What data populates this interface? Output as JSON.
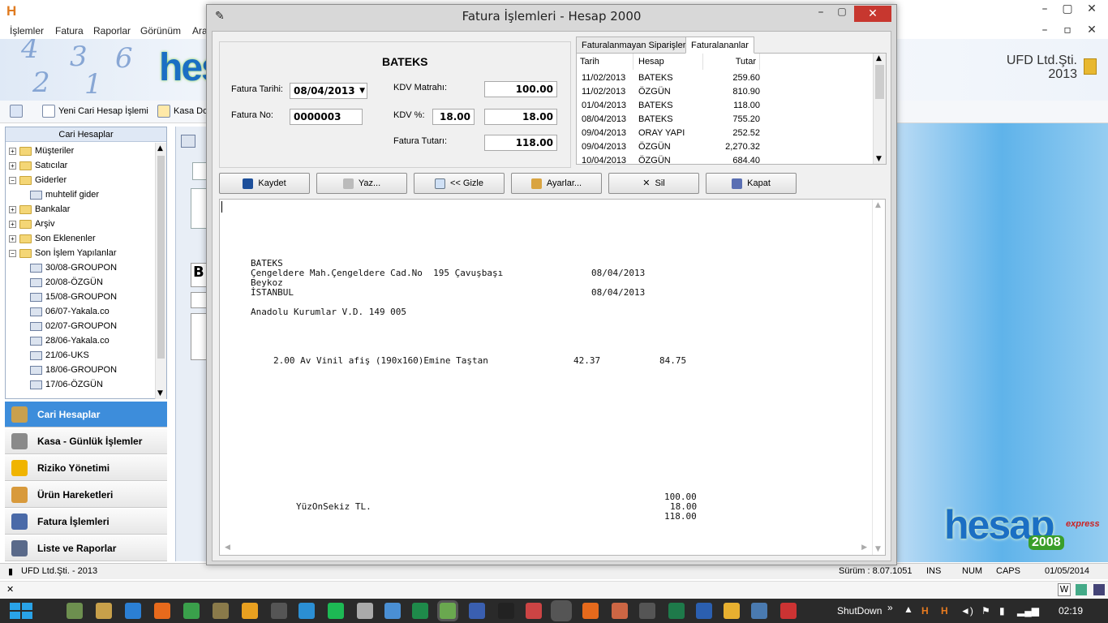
{
  "app": {
    "menu": [
      "İşlemler",
      "Fatura",
      "Raporlar",
      "Görünüm",
      "Ara"
    ],
    "company": "UFD Ltd.Şti.",
    "year": "2013",
    "toolbar": {
      "new_account": "Yeni Cari Hesap İşlemi",
      "cash": "Kasa Do"
    },
    "left_header": "Cari Hesaplar",
    "tree": [
      {
        "label": "Müşteriler",
        "level": 0,
        "type": "folder",
        "exp": "+"
      },
      {
        "label": "Satıcılar",
        "level": 0,
        "type": "folder",
        "exp": "+"
      },
      {
        "label": "Giderler",
        "level": 0,
        "type": "folder",
        "exp": "−"
      },
      {
        "label": "muhtelif gider",
        "level": 1,
        "type": "card",
        "exp": ""
      },
      {
        "label": "Bankalar",
        "level": 0,
        "type": "folder",
        "exp": "+"
      },
      {
        "label": "Arşiv",
        "level": 0,
        "type": "folder",
        "exp": "+"
      },
      {
        "label": "Son Eklenenler",
        "level": 0,
        "type": "folder",
        "exp": "+"
      },
      {
        "label": "Son İşlem Yapılanlar",
        "level": 0,
        "type": "folder",
        "exp": "−"
      },
      {
        "label": "30/08-GROUPON",
        "level": 1,
        "type": "card",
        "exp": ""
      },
      {
        "label": "20/08-ÖZGÜN",
        "level": 1,
        "type": "card",
        "exp": ""
      },
      {
        "label": "15/08-GROUPON",
        "level": 1,
        "type": "card",
        "exp": ""
      },
      {
        "label": "06/07-Yakala.co",
        "level": 1,
        "type": "card",
        "exp": ""
      },
      {
        "label": "02/07-GROUPON",
        "level": 1,
        "type": "card",
        "exp": ""
      },
      {
        "label": "28/06-Yakala.co",
        "level": 1,
        "type": "card",
        "exp": ""
      },
      {
        "label": "21/06-UKS",
        "level": 1,
        "type": "card",
        "exp": ""
      },
      {
        "label": "18/06-GROUPON",
        "level": 1,
        "type": "card",
        "exp": ""
      },
      {
        "label": "17/06-ÖZGÜN",
        "level": 1,
        "type": "card",
        "exp": ""
      }
    ],
    "nav": [
      "Cari Hesaplar",
      "Kasa - Günlük İşlemler",
      "Riziko Yönetimi",
      "Ürün Hareketleri",
      "Fatura İşlemleri",
      "Liste ve Raporlar"
    ],
    "nav_active": 0,
    "status": {
      "company": "UFD Ltd.Şti. - 2013",
      "version": "Sürüm : 8.07.1051",
      "ins": "INS",
      "num": "NUM",
      "caps": "CAPS",
      "date": "01/05/2014"
    },
    "logo_text": "hesap",
    "logo_express": "express",
    "logo_year": "2008"
  },
  "dialog": {
    "title": "Fatura İşlemleri - Hesap 2000",
    "customer": "BATEKS",
    "date_label": "Fatura Tarihi:",
    "date_value": "08/04/2013",
    "no_label": "Fatura No:",
    "no_value": "0000003",
    "kdv_base_label": "KDV Matrahı:",
    "kdv_base_value": "100.00",
    "kdv_pct_label": "KDV %:",
    "kdv_pct_value": "18.00",
    "kdv_amount_value": "18.00",
    "total_label": "Fatura Tutarı:",
    "total_value": "118.00",
    "tabs": [
      "Faturalanmayan Siparişler",
      "Faturalananlar"
    ],
    "active_tab": 1,
    "grid_headers": [
      "Tarih",
      "Hesap",
      "Tutar"
    ],
    "grid_rows": [
      [
        "11/02/2013",
        "BATEKS",
        "259.60"
      ],
      [
        "11/02/2013",
        "ÖZGÜN",
        "810.90"
      ],
      [
        "01/04/2013",
        "BATEKS",
        "118.00"
      ],
      [
        "08/04/2013",
        "BATEKS",
        "755.20"
      ],
      [
        "09/04/2013",
        "ORAY YAPI",
        "252.52"
      ],
      [
        "09/04/2013",
        "ÖZGÜN",
        "2,270.32"
      ],
      [
        "10/04/2013",
        "ÖZGÜN",
        "684.40"
      ]
    ],
    "buttons": [
      "Kaydet",
      "Yaz...",
      "<< Gizle",
      "Ayarlar...",
      "Sil",
      "Kapat"
    ],
    "preview": {
      "name": "BATEKS",
      "address1": "Çengeldere Mah.Çengeldere Cad.No  195 Çavuşbaşı",
      "date1": "08/04/2013",
      "address2": "Beykoz",
      "city": "İSTANBUL",
      "date2": "08/04/2013",
      "tax_office": "Anadolu Kurumlar V.D. 149 005",
      "line_item": "2.00 Av Vinil afiş (190x160)Emine Taştan",
      "unit_price": "42.37",
      "line_total": "84.75",
      "subtotal": "100.00",
      "amount_words": "YüzOnSekiz TL.",
      "vat": "18.00",
      "grand_total": "118.00"
    }
  },
  "taskbar": {
    "shutdown": "ShutDown",
    "clock": "02:19"
  }
}
